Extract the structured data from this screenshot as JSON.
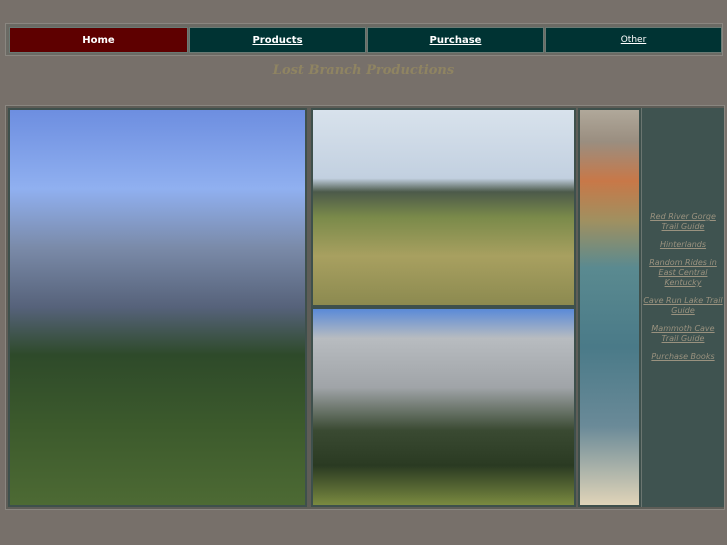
{
  "nav": {
    "items": [
      {
        "label": "Home",
        "active": true
      },
      {
        "label": "Products"
      },
      {
        "label": "Purchase"
      },
      {
        "label": "Other"
      }
    ]
  },
  "title": "Lost Branch Productions",
  "sidebar_links": [
    "Red River Gorge Trail Guide",
    "Hinterlands",
    "Random Rides in East Central Kentucky",
    "Cave Run Lake Trail Guide",
    "Mammoth Cave Trail Guide",
    "Purchase Books"
  ],
  "colors": {
    "background": "#77706a",
    "nav_active": "#5e0000",
    "nav_inactive": "#003333",
    "title": "#8f8462",
    "sidebar": "#3f5350"
  }
}
